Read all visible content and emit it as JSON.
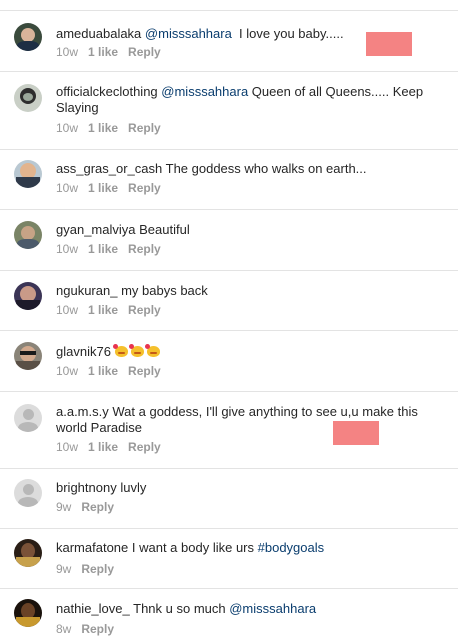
{
  "comments": [
    {
      "username": "ameduabalaka",
      "mention": "@misssahhara",
      "text": "  I love you baby.....",
      "age": "10w",
      "likes": "1 like",
      "reply": "Reply"
    },
    {
      "username": "officialckeclothing",
      "mention": "@misssahhara",
      "text": " Queen of all Queens..... Keep Slaying",
      "age": "10w",
      "likes": "1 like",
      "reply": "Reply"
    },
    {
      "username": "ass_gras_or_cash",
      "mention": "",
      "text": "The goddess who walks on earth...",
      "age": "10w",
      "likes": "1 like",
      "reply": "Reply"
    },
    {
      "username": "gyan_malviya",
      "mention": "",
      "text": "Beautiful",
      "age": "10w",
      "likes": "1 like",
      "reply": "Reply"
    },
    {
      "username": "ngukuran_",
      "mention": "",
      "text": "my babys back",
      "age": "10w",
      "likes": "1 like",
      "reply": "Reply"
    },
    {
      "username": "glavnik76",
      "mention": "",
      "text": "",
      "age": "10w",
      "likes": "1 like",
      "reply": "Reply"
    },
    {
      "username": "a.a.m.s.y",
      "mention": "",
      "text": "Wat a goddess, I'll give anything to see u,u make this world Paradise",
      "age": "10w",
      "likes": "1 like",
      "reply": "Reply"
    },
    {
      "username": "brightnony",
      "mention": "",
      "text": "luvly",
      "age": "9w",
      "likes": "",
      "reply": "Reply"
    },
    {
      "username": "karmafatone",
      "mention": "",
      "text": "I want a body like urs ",
      "hashtag": "#bodygoals",
      "age": "9w",
      "likes": "",
      "reply": "Reply"
    },
    {
      "username": "nathie_love_",
      "mention": "@misssahhara",
      "text": "Thnk u so much ",
      "age": "8w",
      "likes": "",
      "reply": "Reply"
    }
  ],
  "colors": {
    "mention": "#0a3d6e",
    "meta": "#999999",
    "redaction": "#f48383"
  }
}
